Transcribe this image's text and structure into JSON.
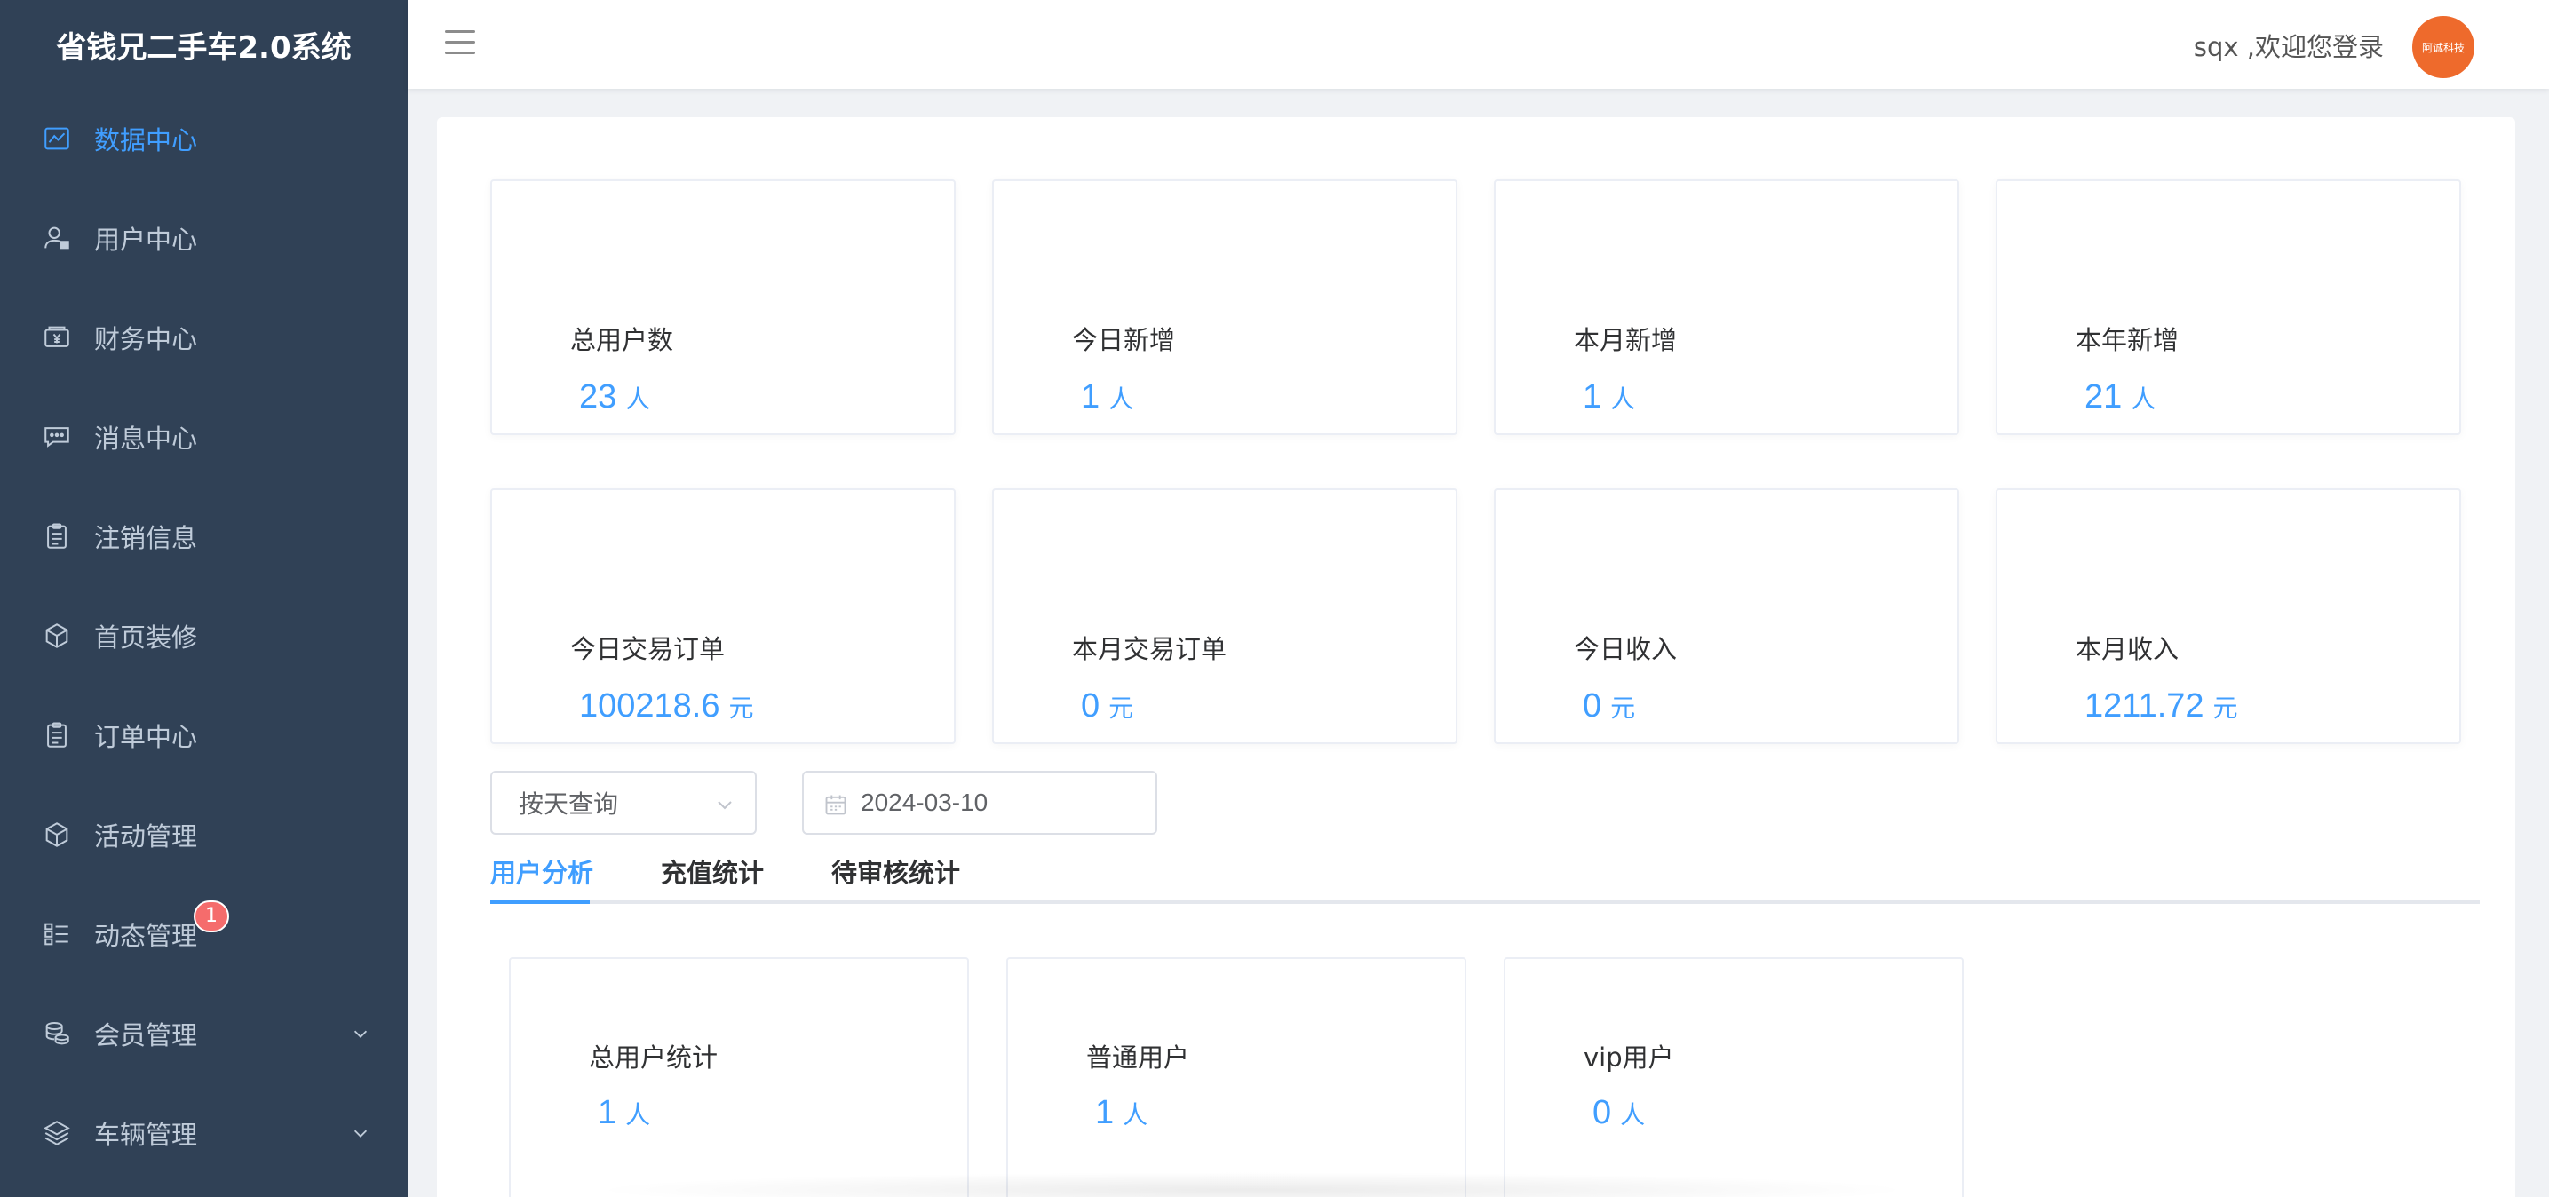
{
  "app": {
    "title": "省钱兄二手车2.0系统"
  },
  "sidebar": {
    "items": [
      {
        "label": "数据中心",
        "icon": "chart-icon",
        "active": true
      },
      {
        "label": "用户中心",
        "icon": "user-icon"
      },
      {
        "label": "财务中心",
        "icon": "wallet-icon"
      },
      {
        "label": "消息中心",
        "icon": "message-icon"
      },
      {
        "label": "注销信息",
        "icon": "clipboard-icon"
      },
      {
        "label": "首页装修",
        "icon": "cube-icon"
      },
      {
        "label": "订单中心",
        "icon": "clipboard-icon"
      },
      {
        "label": "活动管理",
        "icon": "cube-icon"
      },
      {
        "label": "动态管理",
        "icon": "list-icon",
        "badge": "1"
      },
      {
        "label": "会员管理",
        "icon": "coins-icon",
        "expandable": true
      },
      {
        "label": "车辆管理",
        "icon": "layers-icon",
        "expandable": true
      }
    ]
  },
  "header": {
    "welcome": "sqx ,欢迎您登录",
    "avatar_text": "阿诚科技"
  },
  "stats": [
    {
      "title": "总用户数",
      "value": "23",
      "unit": "人"
    },
    {
      "title": "今日新增",
      "value": "1",
      "unit": "人"
    },
    {
      "title": "本月新增",
      "value": "1",
      "unit": "人"
    },
    {
      "title": "本年新增",
      "value": "21",
      "unit": "人"
    },
    {
      "title": "今日交易订单",
      "value": "100218.6",
      "unit": "元"
    },
    {
      "title": "本月交易订单",
      "value": "0",
      "unit": "元"
    },
    {
      "title": "今日收入",
      "value": "0",
      "unit": "元"
    },
    {
      "title": "本月收入",
      "value": "1211.72",
      "unit": "元"
    }
  ],
  "filters": {
    "query_mode": "按天查询",
    "date": "2024-03-10"
  },
  "tabs": [
    {
      "label": "用户分析",
      "active": true
    },
    {
      "label": "充值统计"
    },
    {
      "label": "待审核统计"
    }
  ],
  "user_analysis": [
    {
      "title": "总用户统计",
      "value": "1",
      "unit": "人"
    },
    {
      "title": "普通用户",
      "value": "1",
      "unit": "人"
    },
    {
      "title": "vip用户",
      "value": "0",
      "unit": "人"
    }
  ],
  "colors": {
    "sidebar_bg": "#304156",
    "accent": "#409eff",
    "badge": "#f56c6c",
    "avatar": "#ee6a2c"
  }
}
